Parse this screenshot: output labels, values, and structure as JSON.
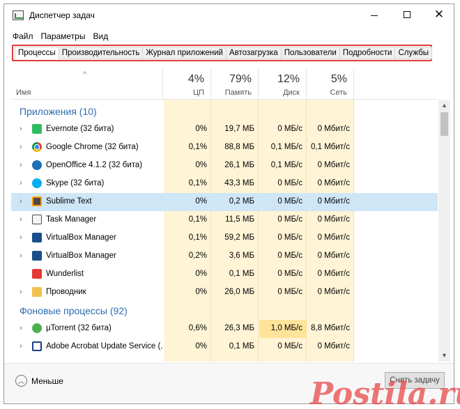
{
  "window": {
    "title": "Диспетчер задач"
  },
  "menu": [
    "Файл",
    "Параметры",
    "Вид"
  ],
  "tabs": [
    "Процессы",
    "Производительность",
    "Журнал приложений",
    "Автозагрузка",
    "Пользователи",
    "Подробности",
    "Службы"
  ],
  "active_tab": "Процессы",
  "columns": {
    "name": "Имя",
    "cpu": {
      "percent": "4%",
      "label": "ЦП"
    },
    "memory": {
      "percent": "79%",
      "label": "Память"
    },
    "disk": {
      "percent": "12%",
      "label": "Диск"
    },
    "network": {
      "percent": "5%",
      "label": "Сеть"
    }
  },
  "groups": [
    {
      "title": "Приложения (10)",
      "rows": [
        {
          "name": "Evernote (32 бита)",
          "icon": "evernote-icon",
          "cpu": "0%",
          "mem": "19,7 МБ",
          "disk": "0 МБ/с",
          "net": "0 Мбит/с"
        },
        {
          "name": "Google Chrome (32 бита)",
          "icon": "chrome-icon",
          "cpu": "0,1%",
          "mem": "88,8 МБ",
          "disk": "0,1 МБ/с",
          "net": "0,1 Мбит/с"
        },
        {
          "name": "OpenOffice 4.1.2 (32 бита)",
          "icon": "openoffice-icon",
          "cpu": "0%",
          "mem": "26,1 МБ",
          "disk": "0,1 МБ/с",
          "net": "0 Мбит/с"
        },
        {
          "name": "Skype (32 бита)",
          "icon": "skype-icon",
          "cpu": "0,1%",
          "mem": "43,3 МБ",
          "disk": "0 МБ/с",
          "net": "0 Мбит/с"
        },
        {
          "name": "Sublime Text",
          "icon": "sublime-icon",
          "cpu": "0%",
          "mem": "0,2 МБ",
          "disk": "0 МБ/с",
          "net": "0 Мбит/с",
          "selected": true
        },
        {
          "name": "Task Manager",
          "icon": "task-manager-icon",
          "cpu": "0,1%",
          "mem": "11,5 МБ",
          "disk": "0 МБ/с",
          "net": "0 Мбит/с"
        },
        {
          "name": "VirtualBox Manager",
          "icon": "virtualbox-icon",
          "cpu": "0,1%",
          "mem": "59,2 МБ",
          "disk": "0 МБ/с",
          "net": "0 Мбит/с"
        },
        {
          "name": "VirtualBox Manager",
          "icon": "virtualbox-icon",
          "cpu": "0,2%",
          "mem": "3,6 МБ",
          "disk": "0 МБ/с",
          "net": "0 Мбит/с"
        },
        {
          "name": "Wunderlist",
          "icon": "wunderlist-icon",
          "cpu": "0%",
          "mem": "0,1 МБ",
          "disk": "0 МБ/с",
          "net": "0 Мбит/с",
          "no_chevron": true
        },
        {
          "name": "Проводник",
          "icon": "explorer-icon",
          "cpu": "0%",
          "mem": "26,0 МБ",
          "disk": "0 МБ/с",
          "net": "0 Мбит/с"
        }
      ]
    },
    {
      "title": "Фоновые процессы (92)",
      "rows": [
        {
          "name": "µTorrent (32 бита)",
          "icon": "utorrent-icon",
          "cpu": "0,6%",
          "mem": "26,3 МБ",
          "disk": "1,0 МБ/с",
          "net": "8,8 Мбит/с",
          "hot_disk": true
        },
        {
          "name": "Adobe Acrobat Update Service (...",
          "icon": "acrobat-update-icon",
          "cpu": "0%",
          "mem": "0,1 МБ",
          "disk": "0 МБ/с",
          "net": "0 Мбит/с"
        }
      ]
    }
  ],
  "footer": {
    "less_label": "Меньше",
    "end_task_label": "Снять задачу"
  },
  "watermark": "Postila.ru",
  "colors": {
    "accent_red": "#e23a3a",
    "group_title": "#2c6bb0",
    "column_bg": "#fff4d6",
    "selection": "#cfe6f7",
    "hot_cell": "#ffe39b"
  }
}
